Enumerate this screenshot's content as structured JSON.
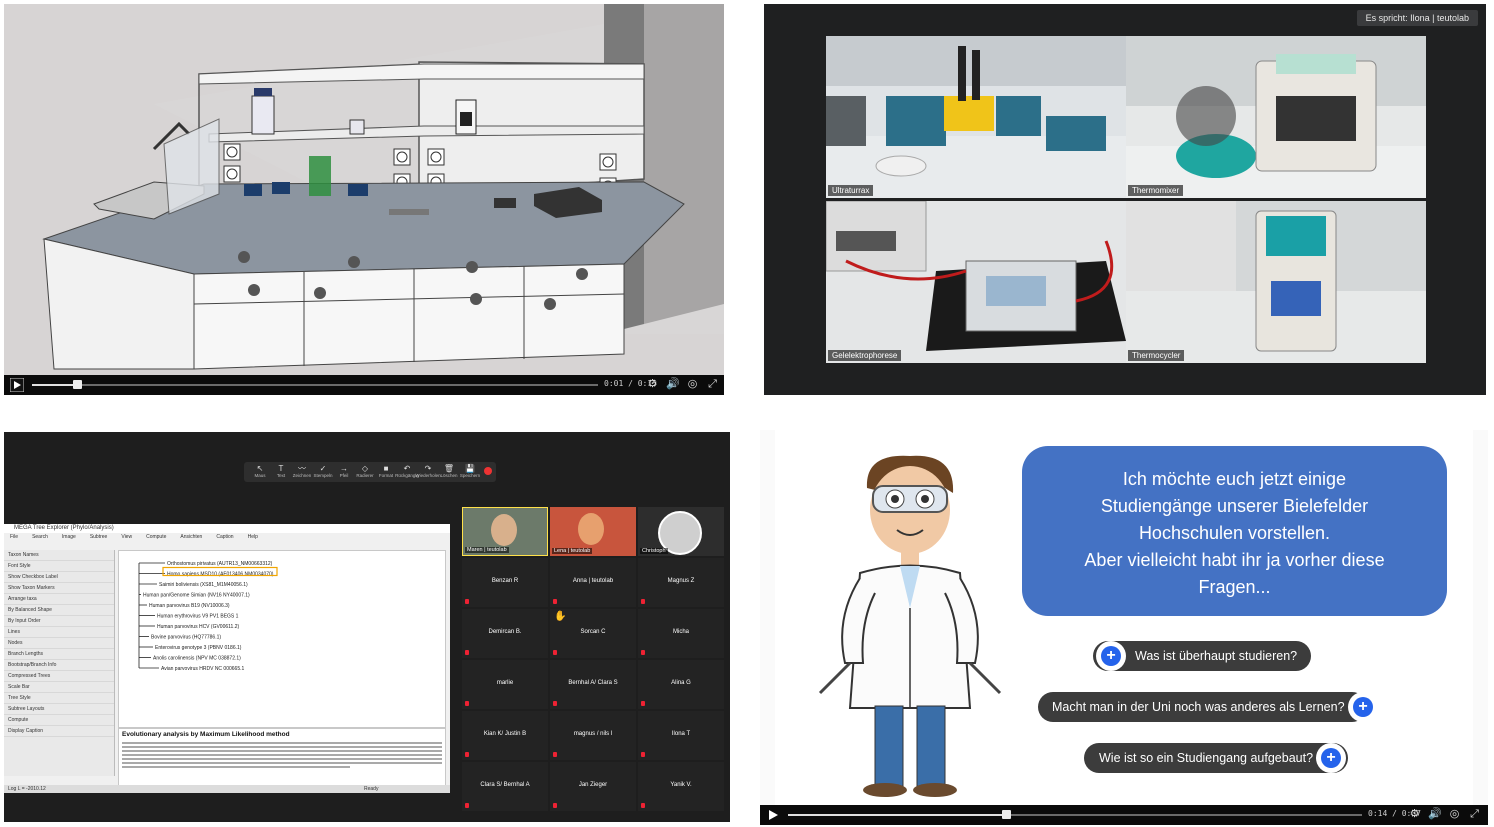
{
  "panelA": {
    "player": {
      "time": "0:01 / 0:15",
      "progress": 0.08
    }
  },
  "panelB": {
    "speaking": "Es spricht: Ilona | teutolab",
    "cams": [
      {
        "label": "Ultraturrax"
      },
      {
        "label": "Thermomixer"
      },
      {
        "label": "Gelelektrophorese"
      },
      {
        "label": "Thermocycler"
      }
    ]
  },
  "panelC": {
    "toolbar": [
      "Maus",
      "Text",
      "Zeichnen",
      "Stempeln",
      "Pfeil",
      "Radierer",
      "Format",
      "Rückgängig",
      "Wiederholen",
      "Löschen",
      "Speichern"
    ],
    "mega": {
      "title": "MEGA Tree Explorer (Phylo/Analysis)",
      "menu": [
        "File",
        "Search",
        "Image",
        "Subtree",
        "View",
        "Compute",
        "Ansichten",
        "Caption",
        "Help"
      ],
      "left_rows": [
        "Taxon Names",
        "Font Style",
        "Show Checkbox Label",
        "Show Taxon Markers",
        "Arrange taxa",
        "By Balanced Shape",
        "By Input Order",
        "Lines",
        "Nodes",
        "Branch Lengths",
        "Bootstrap/Branch Info",
        "Compressed Trees",
        "Scale Bar",
        "Tree Style",
        "Subtree Layouts",
        "Compute",
        "Display Caption"
      ],
      "leaves": [
        "Orthostomus pirivatus (AUTR13_NM00663312)",
        "Homo sapiens MSD10 (AF013406 NM0034070)",
        "Saimiri boliviensis (XS81_M1M40056.1)",
        "Human pan/Genome Simian (NV16 NY40007.1)",
        "Human parvovirus B19 (NV10006.3)",
        "Human erythrovirus V9 PV1 BEGS 1",
        "Human parvovirus HCV (GV00611.2)",
        "Bovine parvovirus (HQ77786.1)",
        "Enterovirus genotype 3 (PBNV 0186.1)",
        "Anolis carolinensis (NPV MC 038872.1)",
        "Avian parvovirus HRDV NC 000665.1"
      ],
      "caption_title": "Evolutionary analysis by Maximum Likelihood method",
      "status_left": "Log L = -2010.12",
      "status_right": "Ready"
    },
    "participants": [
      {
        "name": "Maren | teutolab",
        "video": true,
        "mic_muted": false
      },
      {
        "name": "Lena | teutolab",
        "video": true,
        "mic_muted": false
      },
      {
        "name": "Christoph",
        "video": true,
        "mic_muted": false
      },
      {
        "name": "Benzan R",
        "video": false,
        "mic_muted": true
      },
      {
        "name": "Anna | teutolab",
        "video": false,
        "mic_muted": true
      },
      {
        "name": "Magnus Z",
        "video": false,
        "mic_muted": true
      },
      {
        "name": "Demircan B.",
        "video": false,
        "mic_muted": true,
        "hand_raised": false
      },
      {
        "name": "Sorcan C",
        "video": false,
        "mic_muted": true,
        "hand_raised": true
      },
      {
        "name": "Micha",
        "video": false,
        "mic_muted": true
      },
      {
        "name": "marlie",
        "video": false,
        "mic_muted": true
      },
      {
        "name": "Bernhal A/ Clara S",
        "video": false,
        "mic_muted": true
      },
      {
        "name": "Alina G",
        "video": false,
        "mic_muted": true
      },
      {
        "name": "Kian K/ Justin B",
        "video": false,
        "mic_muted": true
      },
      {
        "name": "magnus / nils l",
        "video": false,
        "mic_muted": true
      },
      {
        "name": "Ilona T",
        "video": false,
        "mic_muted": true
      },
      {
        "name": "Clara S/ Bernhal A",
        "video": false,
        "mic_muted": true
      },
      {
        "name": "Jan Zieger",
        "video": false,
        "mic_muted": true
      },
      {
        "name": "Yanik V.",
        "video": false,
        "mic_muted": true
      }
    ]
  },
  "panelD": {
    "bubble_lines": [
      "Ich möchte euch jetzt einige",
      "Studiengänge unserer Bielefelder",
      "Hochschulen vorstellen.",
      "Aber vielleicht habt ihr ja vorher diese",
      "Fragen..."
    ],
    "buttons": [
      "Was ist überhaupt studieren?",
      "Macht man in der Uni noch was anderes als Lernen?",
      "Wie ist so ein Studiengang aufgebaut?"
    ],
    "player": {
      "time": "0:14 / 0:37",
      "progress": 0.38
    },
    "bubble_color": "#4472c4",
    "accent": "#2563eb"
  }
}
